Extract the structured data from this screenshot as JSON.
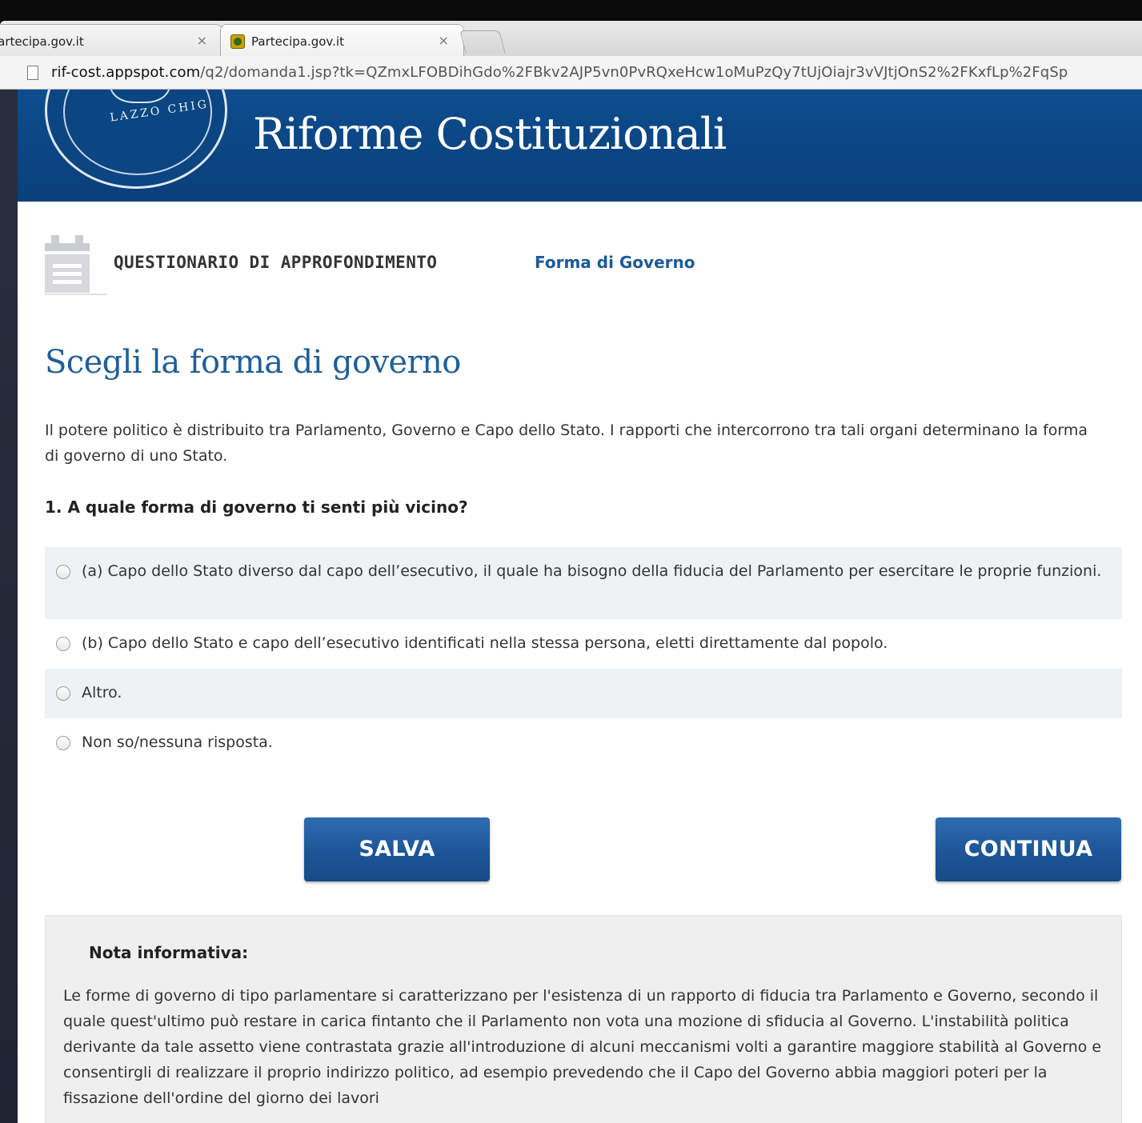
{
  "browser": {
    "tabs": [
      {
        "label": "'artecipa.gov.it"
      },
      {
        "label": "Partecipa.gov.it"
      }
    ],
    "close_glyph": "×",
    "url_host": "rif-cost.appspot.com",
    "url_path": "/q2/domanda1.jsp?tk=QZmxLFOBDihGdo%2FBkv2AJP5vn0PvRQxeHcw1oMuPzQy7tUjOiajr3vVJtjOnS2%2FKxfLp%2FqSp"
  },
  "header": {
    "seal_text": "LAZZO CHIG",
    "site_title": "Riforme Costituzionali"
  },
  "questionnaire": {
    "label": "QUESTIONARIO DI APPROFONDIMENTO",
    "section": "Forma di Governo"
  },
  "main": {
    "title": "Scegli la forma di governo",
    "intro": "Il potere politico è distribuito tra Parlamento, Governo e Capo dello Stato. I rapporti che intercorrono tra tali organi determinano la forma di governo di uno Stato.",
    "question": "1. A quale forma di governo ti senti più vicino?",
    "options": [
      {
        "label": "(a) Capo dello Stato diverso dal capo dell’esecutivo, il quale ha bisogno della fiducia del Parlamento per esercitare le proprie funzioni."
      },
      {
        "label": "(b) Capo dello Stato e capo dell’esecutivo identificati nella stessa persona, eletti direttamente dal popolo."
      },
      {
        "label": "Altro."
      },
      {
        "label": "Non so/nessuna risposta."
      }
    ],
    "save_label": "SALVA",
    "continue_label": "CONTINUA"
  },
  "note": {
    "title": "Nota informativa:",
    "body": "Le forme di governo di tipo parlamentare si caratterizzano per l'esistenza di un rapporto di fiducia tra Parlamento e Governo, secondo il quale quest'ultimo può restare in carica fintanto che il Parlamento non vota una mozione di sfiducia al Governo. L'instabilità politica derivante da tale assetto viene contrastata grazie all'introduzione di alcuni meccanismi volti a garantire maggiore stabilità al Governo e consentirgli di realizzare il proprio indirizzo politico, ad esempio prevedendo che il Capo del Governo abbia maggiori poteri per la fissazione dell'ordine del giorno dei lavori"
  },
  "icons": {
    "tab_favicon": "seal-favicon-icon",
    "url_page": "page-icon",
    "questionnaire": "clipboard-list-icon",
    "radio": "radio-icon"
  },
  "colors": {
    "banner": "#0d4d8f",
    "accent": "#1f5f9a",
    "button": "#1c5598",
    "option_stripe": "#eef2f4",
    "note_bg": "#efefef"
  }
}
